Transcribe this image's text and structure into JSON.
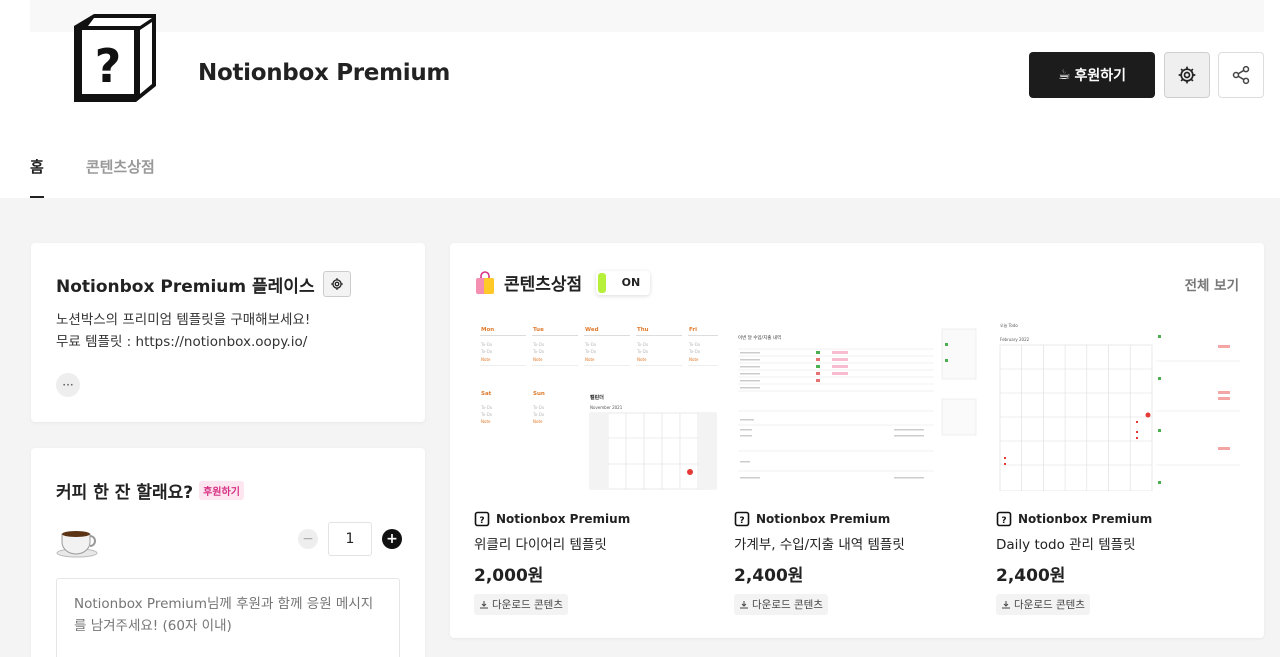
{
  "header": {
    "brand": "Notionbox Premium",
    "sponsor_label": "후원하기",
    "sponsor_icon": "coffee-cup-icon"
  },
  "tabs": [
    {
      "label": "홈",
      "active": true
    },
    {
      "label": "콘텐츠상점",
      "active": false
    }
  ],
  "place": {
    "title": "Notionbox Premium 플레이스",
    "desc_line1": "노션박스의 프리미엄 템플릿을 구매해보세요!",
    "desc_line2": "무료 템플릿 : https://notionbox.oopy.io/",
    "more_label": "···"
  },
  "coffee": {
    "title": "커피 한 잔 할래요?",
    "badge": "후원하기",
    "quantity": "1",
    "placeholder": "Notionbox Premium님께 후원과 함께 응원 메시지를 남겨주세요! (60자 이내)"
  },
  "store": {
    "title": "콘텐츠상점",
    "toggle_label": "ON",
    "toggle_color": "#b7f03a",
    "view_all": "전체 보기",
    "products": [
      {
        "seller": "Notionbox Premium",
        "name": "위클리 다이어리 템플릿",
        "price": "2,000원",
        "download": "다운로드 콘텐츠"
      },
      {
        "seller": "Notionbox Premium",
        "name": "가계부, 수입/지출 내역 템플릿",
        "price": "2,400원",
        "download": "다운로드 콘텐츠"
      },
      {
        "seller": "Notionbox Premium",
        "name": "Daily todo 관리 템플릿",
        "price": "2,400원",
        "download": "다운로드 콘텐츠"
      }
    ]
  },
  "thumb1": {
    "days": [
      "Mon",
      "Tue",
      "Wed",
      "Thu",
      "Fri",
      "Sat",
      "Sun"
    ],
    "todo": "To-Do",
    "note": "Note",
    "cal_title": "캘린더",
    "cal_month": "November 2021"
  },
  "thumb2": {
    "title": "이번 달 수입/지출 내역"
  },
  "thumb3": {
    "title": "오늘 Todo",
    "month": "February 2022"
  }
}
